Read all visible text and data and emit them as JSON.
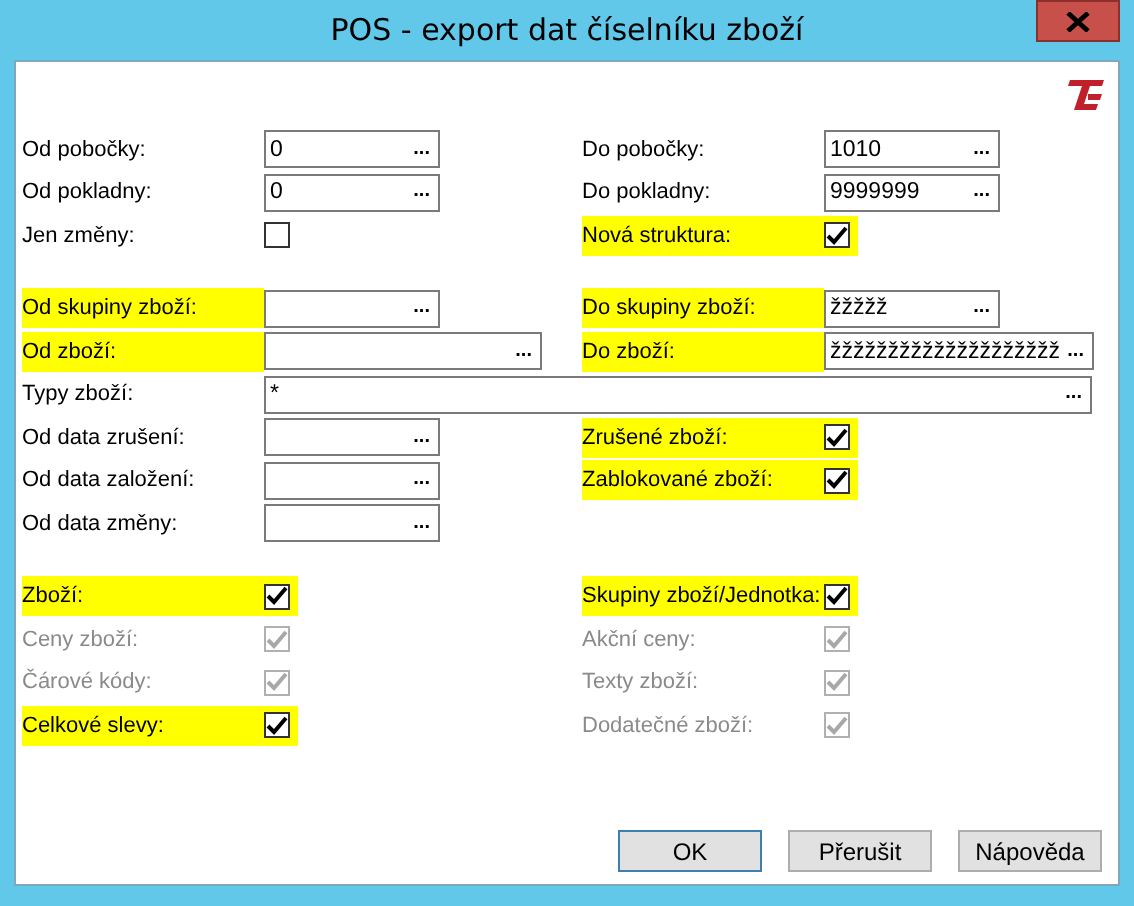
{
  "window": {
    "title": "POS - export dat číselníku zboží"
  },
  "groups": [
    {
      "rows": [
        {
          "left": {
            "kind": "field",
            "label": "Od pobočky:",
            "value": "0",
            "highlighted": false
          },
          "right": {
            "kind": "field",
            "label": "Do pobočky:",
            "value": "1010",
            "highlighted": false
          }
        },
        {
          "left": {
            "kind": "field",
            "label": "Od pokladny:",
            "value": "0",
            "highlighted": false
          },
          "right": {
            "kind": "field",
            "label": "Do pokladny:",
            "value": "9999999",
            "highlighted": false
          }
        },
        {
          "left": {
            "kind": "checkbox",
            "label": "Jen změny:",
            "checked": false,
            "disabled": false,
            "highlighted": false
          },
          "right": {
            "kind": "checkbox",
            "label": "Nová struktura:",
            "checked": true,
            "disabled": false,
            "highlighted": true
          }
        }
      ]
    },
    {
      "rows": [
        {
          "left": {
            "kind": "field",
            "label": "Od skupiny zboží:",
            "highlighted": true
          },
          "right": {
            "kind": "field",
            "label": "Do skupiny zboží:",
            "value": "žžžžž",
            "highlighted": true
          }
        },
        {
          "left": {
            "kind": "wide-field",
            "label": "Od zboží:",
            "highlighted": true
          },
          "right": {
            "kind": "wide-field",
            "label": "Do zboží:",
            "value": "žžžžžžžžžžžžžžžžžžžž",
            "highlighted": true
          }
        },
        {
          "left": {
            "kind": "full-field",
            "label": "Typy zboží:",
            "value": "*",
            "highlighted": false
          }
        },
        {
          "left": {
            "kind": "field",
            "label": "Od data zrušení:",
            "highlighted": false
          },
          "right": {
            "kind": "checkbox",
            "label": "Zrušené zboží:",
            "checked": true,
            "disabled": false,
            "highlighted": true
          }
        },
        {
          "left": {
            "kind": "field",
            "label": "Od data založení:",
            "highlighted": false
          },
          "right": {
            "kind": "checkbox",
            "label": "Zablokované zboží:",
            "checked": true,
            "disabled": false,
            "highlighted": true
          }
        },
        {
          "left": {
            "kind": "field",
            "label": "Od data změny:",
            "highlighted": false
          }
        }
      ]
    },
    {
      "rows": [
        {
          "left": {
            "kind": "checkbox",
            "label": "Zboží:",
            "checked": true,
            "disabled": false,
            "highlighted": true
          },
          "right": {
            "kind": "checkbox",
            "label": "Skupiny zboží/Jednotka:",
            "checked": true,
            "disabled": false,
            "highlighted": true
          }
        },
        {
          "left": {
            "kind": "checkbox",
            "label": "Ceny zboží:",
            "checked": true,
            "disabled": true,
            "highlighted": false
          },
          "right": {
            "kind": "checkbox",
            "label": "Akční ceny:",
            "checked": true,
            "disabled": true,
            "highlighted": false
          }
        },
        {
          "left": {
            "kind": "checkbox",
            "label": "Čárové kódy:",
            "checked": true,
            "disabled": true,
            "highlighted": false
          },
          "right": {
            "kind": "checkbox",
            "label": "Texty zboží:",
            "checked": true,
            "disabled": true,
            "highlighted": false
          }
        },
        {
          "left": {
            "kind": "checkbox",
            "label": "Celkové slevy:",
            "checked": true,
            "disabled": false,
            "highlighted": true
          },
          "right": {
            "kind": "checkbox",
            "label": "Dodatečné zboží:",
            "checked": true,
            "disabled": true,
            "highlighted": false
          }
        }
      ]
    }
  ],
  "browse_button": "...",
  "buttons": [
    "OK",
    "Přerušit",
    "Nápověda"
  ]
}
